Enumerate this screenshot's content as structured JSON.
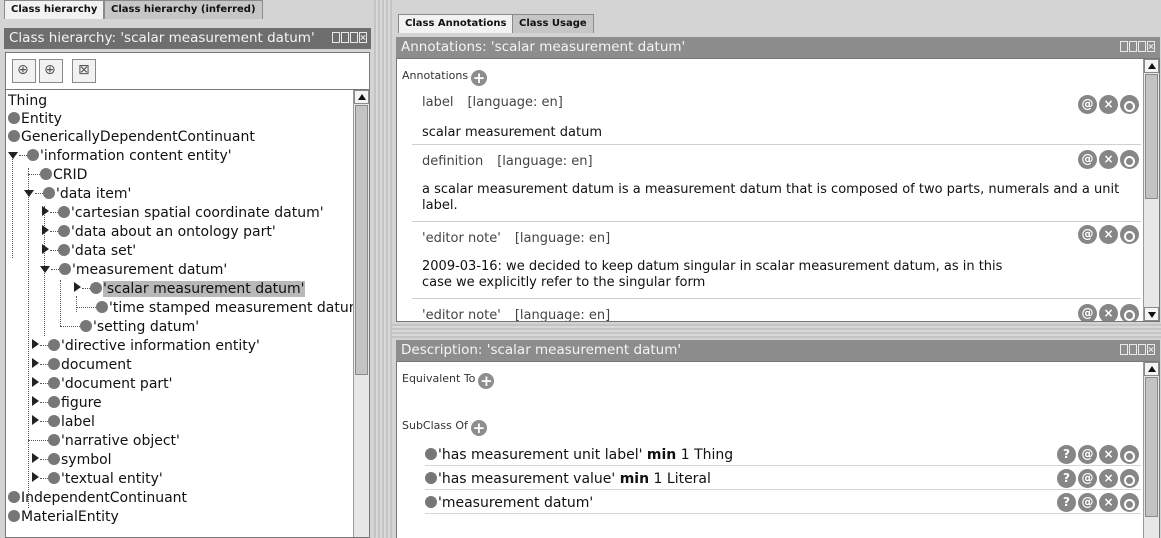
{
  "left": {
    "tabs": [
      "Class hierarchy",
      "Class hierarchy (inferred)"
    ],
    "title": "Class hierarchy: 'scalar measurement datum'",
    "toolbar_icons": [
      "add-subclass-icon",
      "add-sibling-icon",
      "delete-class-icon"
    ],
    "tree": [
      {
        "label": "Thing"
      },
      {
        "label": "Entity"
      },
      {
        "label": "GenericallyDependentContinuant"
      },
      {
        "label": "'information content entity'"
      },
      {
        "label": "CRID"
      },
      {
        "label": "'data item'"
      },
      {
        "label": "'cartesian spatial coordinate datum'"
      },
      {
        "label": "'data about an ontology part'"
      },
      {
        "label": "'data set'"
      },
      {
        "label": "'measurement datum'"
      },
      {
        "label": "'scalar measurement datum'"
      },
      {
        "label": "'time stamped measurement datum'"
      },
      {
        "label": "'setting datum'"
      },
      {
        "label": "'directive information entity'"
      },
      {
        "label": "document"
      },
      {
        "label": "'document part'"
      },
      {
        "label": "figure"
      },
      {
        "label": "label"
      },
      {
        "label": "'narrative object'"
      },
      {
        "label": "symbol"
      },
      {
        "label": "'textual entity'"
      },
      {
        "label": "IndependentContinuant"
      },
      {
        "label": "MaterialEntity"
      }
    ]
  },
  "right": {
    "tabs": [
      "Class Annotations",
      "Class Usage"
    ],
    "annotations_title": "Annotations: 'scalar measurement datum'",
    "annotations_header": "Annotations",
    "annotations": [
      {
        "property": "label",
        "lang": "[language: en]",
        "value": "scalar measurement datum"
      },
      {
        "property": "definition",
        "lang": "[language: en]",
        "value": "a scalar measurement datum is a measurement datum that is composed of two parts, numerals and a unit label."
      },
      {
        "property": "'editor note'",
        "lang": "[language: en]",
        "value": "2009-03-16: we decided to keep datum singular in scalar measurement datum, as in this case we explicitly refer to the singular form"
      },
      {
        "property": "'editor note'",
        "lang": "[language: en]",
        "value": ""
      }
    ],
    "description_title": "Description: 'scalar measurement datum'",
    "equivalent_to": "Equivalent To",
    "subclass_of": "SubClass Of",
    "superclasses": [
      {
        "pre": "'has measurement unit label'",
        "kw": "min",
        "post": "1 Thing"
      },
      {
        "pre": "'has measurement value'",
        "kw": "min",
        "post": "1 Literal"
      },
      {
        "pre": "'measurement datum'",
        "kw": "",
        "post": ""
      }
    ],
    "button_glyphs": {
      "help": "?",
      "annotate": "@",
      "remove": "×"
    }
  }
}
